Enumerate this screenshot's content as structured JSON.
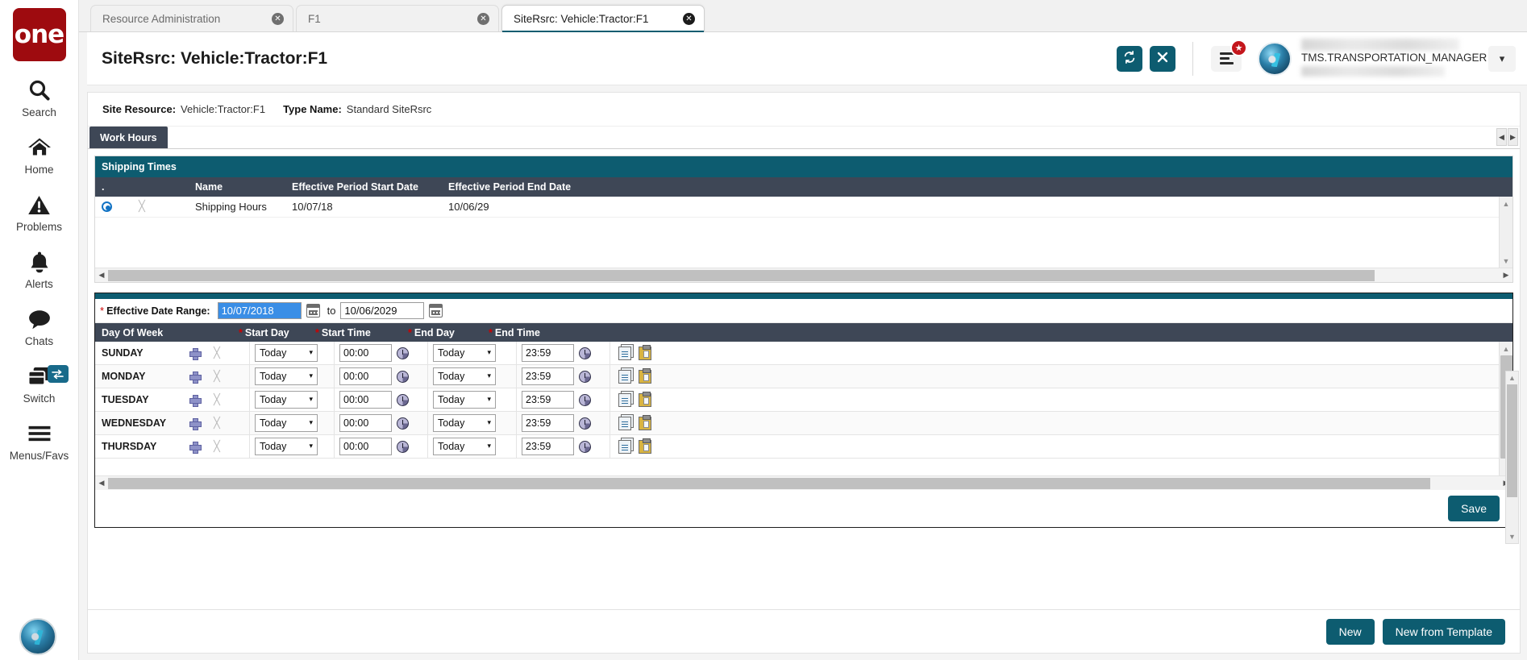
{
  "brand": {
    "logo_text": "one",
    "accent": "#0d5c70",
    "logo_bg": "#9e0b0f"
  },
  "sidebar": {
    "items": [
      {
        "label": "Search",
        "icon": "search-icon"
      },
      {
        "label": "Home",
        "icon": "home-icon"
      },
      {
        "label": "Problems",
        "icon": "warning-triangle-icon"
      },
      {
        "label": "Alerts",
        "icon": "bell-icon"
      },
      {
        "label": "Chats",
        "icon": "chat-bubble-icon"
      },
      {
        "label": "Switch",
        "icon": "windows-stack-icon",
        "badge_icon": "swap-arrows-icon"
      },
      {
        "label": "Menus/Favs",
        "icon": "hamburger-icon"
      }
    ]
  },
  "tabs": [
    {
      "label": "Resource Administration",
      "active": false
    },
    {
      "label": "F1",
      "active": false
    },
    {
      "label": "SiteRsrc: Vehicle:Tractor:F1",
      "active": true
    }
  ],
  "header": {
    "title": "SiteRsrc: Vehicle:Tractor:F1",
    "refresh_icon": "refresh-icon",
    "close_icon": "close-icon",
    "menu_icon": "hamburger-icon",
    "favorite_badge_icon": "star-icon",
    "user_name": "TMS.TRANSPORTATION_MANAGER",
    "user_caret_icon": "chevron-down-icon"
  },
  "breadcrumb": {
    "site_resource_label": "Site Resource:",
    "site_resource_value": "Vehicle:Tractor:F1",
    "type_name_label": "Type Name:",
    "type_name_value": "Standard SiteRsrc"
  },
  "work_tab": {
    "label": "Work Hours",
    "prev_icon": "chevron-left-icon",
    "next_icon": "chevron-right-icon"
  },
  "shipping_times": {
    "title": "Shipping Times",
    "columns": [
      ".",
      "Name",
      "Effective Period Start Date",
      "Effective Period End Date"
    ],
    "rows": [
      {
        "selected": true,
        "delete_icon": "x-delete-icon",
        "name": "Shipping Hours",
        "start_date": "10/07/18",
        "end_date": "10/06/29"
      }
    ]
  },
  "detail": {
    "date_range_label": "Effective Date Range:",
    "required_marker": "*",
    "start_date": "10/07/2018",
    "to_text": "to",
    "end_date": "10/06/2029",
    "calendar_icon": "calendar-icon",
    "columns": [
      "Day Of Week",
      "Start Day",
      "Start Time",
      "End Day",
      "End Time"
    ],
    "column_required": [
      false,
      true,
      true,
      true,
      true
    ],
    "rows": [
      {
        "day": "SUNDAY",
        "start_day": "Today",
        "start_time": "00:00",
        "end_day": "Today",
        "end_time": "23:59"
      },
      {
        "day": "MONDAY",
        "start_day": "Today",
        "start_time": "00:00",
        "end_day": "Today",
        "end_time": "23:59"
      },
      {
        "day": "TUESDAY",
        "start_day": "Today",
        "start_time": "00:00",
        "end_day": "Today",
        "end_time": "23:59"
      },
      {
        "day": "WEDNESDAY",
        "start_day": "Today",
        "start_time": "00:00",
        "end_day": "Today",
        "end_time": "23:59"
      },
      {
        "day": "THURSDAY",
        "start_day": "Today",
        "start_time": "00:00",
        "end_day": "Today",
        "end_time": "23:59"
      }
    ],
    "row_icons": {
      "add_icon": "plus-add-icon",
      "delete_icon": "x-delete-icon",
      "copy_icon": "copy-icon",
      "paste_icon": "paste-icon",
      "clock_icon": "clock-icon",
      "dropdown_icon": "chevron-down-icon"
    },
    "save_label": "Save"
  },
  "footer": {
    "new_label": "New",
    "new_from_template_label": "New from Template"
  }
}
